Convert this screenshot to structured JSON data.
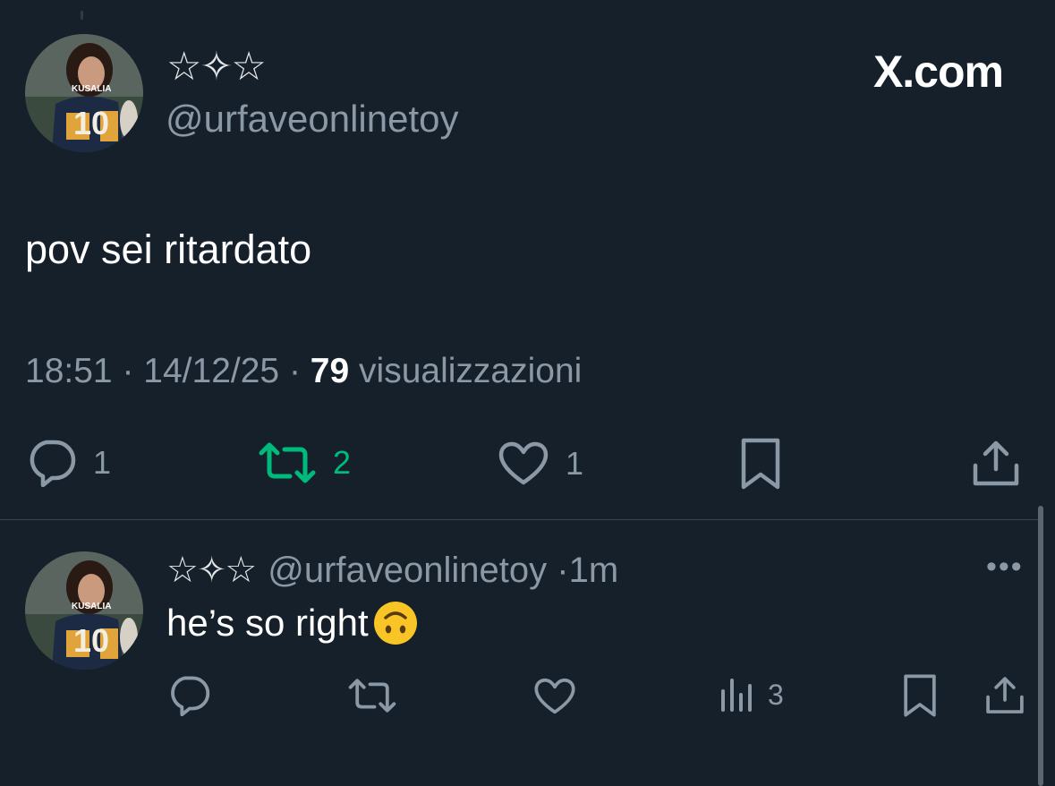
{
  "post": {
    "author_name": "☆✧☆",
    "author_handle": "@urfaveonlinetoy",
    "brand": "X.com",
    "text": "pov sei ritardato",
    "time": "18:51",
    "date": "14/12/25",
    "views_count": "79",
    "views_label": "visualizzazioni",
    "separator": "·",
    "actions": {
      "reply_count": "1",
      "repost_count": "2",
      "like_count": "1"
    },
    "avatar_jersey_text": "KUSALIA",
    "avatar_jersey_number": "10"
  },
  "reply": {
    "author_name": "☆✧☆",
    "author_handle": "@urfaveonlinetoy",
    "separator": "·",
    "age": "1m",
    "text": "he’s so right",
    "emoji": "🙃",
    "more_label": "•••",
    "actions": {
      "views_count": "3"
    },
    "avatar_jersey_text": "KUSALIA",
    "avatar_jersey_number": "10"
  },
  "colors": {
    "background": "#15202b",
    "text_primary": "#e7e9ea",
    "text_secondary": "#8b98a5",
    "repost_active": "#00ba7c"
  }
}
